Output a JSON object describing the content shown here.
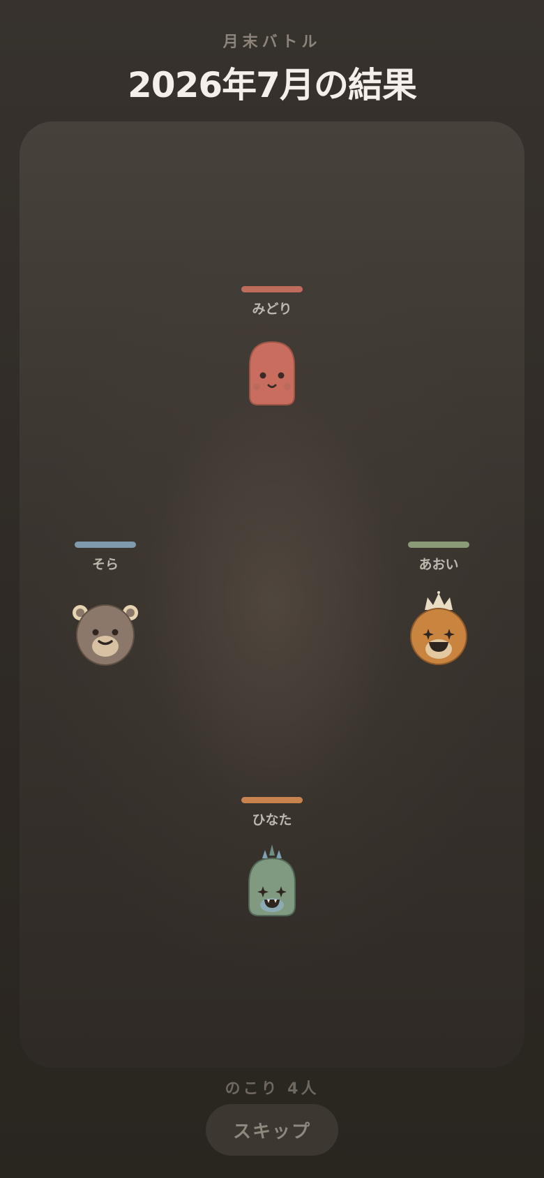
{
  "header": {
    "subtitle": "月末バトル",
    "title": "2026年7月の結果"
  },
  "players": [
    {
      "name": "みどり",
      "hp_color": "#c06c5c",
      "avatar_icon": "blob-character-icon",
      "body_color": "#c96e5e"
    },
    {
      "name": "そら",
      "hp_color": "#7f9bab",
      "avatar_icon": "bear-character-icon",
      "body_color": "#8c786a"
    },
    {
      "name": "あおい",
      "hp_color": "#8a9b78",
      "avatar_icon": "crowned-lion-character-icon",
      "body_color": "#c9843f"
    },
    {
      "name": "ひなた",
      "hp_color": "#c9834f",
      "avatar_icon": "dino-character-icon",
      "body_color": "#7f9a80"
    }
  ],
  "footer": {
    "remaining": "のこり 4人",
    "skip_label": "スキップ"
  }
}
